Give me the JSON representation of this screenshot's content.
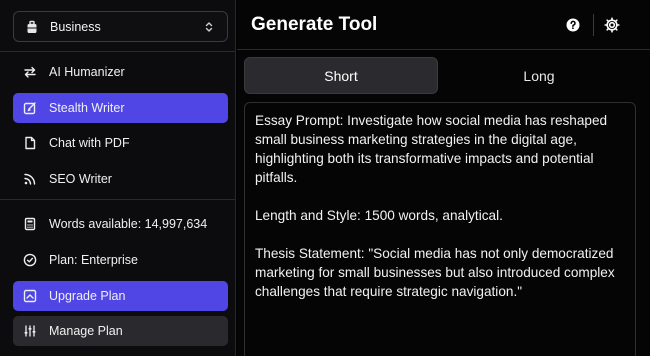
{
  "workspace": {
    "name": "Business"
  },
  "sidebar": {
    "tools": [
      {
        "label": "AI Humanizer"
      },
      {
        "label": "Stealth Writer"
      },
      {
        "label": "Chat with PDF"
      },
      {
        "label": "SEO Writer"
      }
    ],
    "words_available": "Words available: 14,997,634",
    "plan": "Plan: Enterprise",
    "upgrade_label": "Upgrade Plan",
    "manage_label": "Manage Plan"
  },
  "header": {
    "title": "Generate Tool"
  },
  "tabs": [
    {
      "label": "Short"
    },
    {
      "label": "Long"
    }
  ],
  "editor": {
    "paragraphs": [
      "Essay Prompt: Investigate how social media has reshaped small business marketing strategies in the digital age, highlighting both its transformative impacts and potential pitfalls.",
      "Length and Style: 1500 words, analytical.",
      "Thesis Statement: \"Social media has not only democratized marketing for small businesses but also introduced complex challenges that require strategic navigation.\""
    ]
  },
  "colors": {
    "accent": "#4f46e5",
    "background": "#000000",
    "panel": "#2b2b2f"
  }
}
